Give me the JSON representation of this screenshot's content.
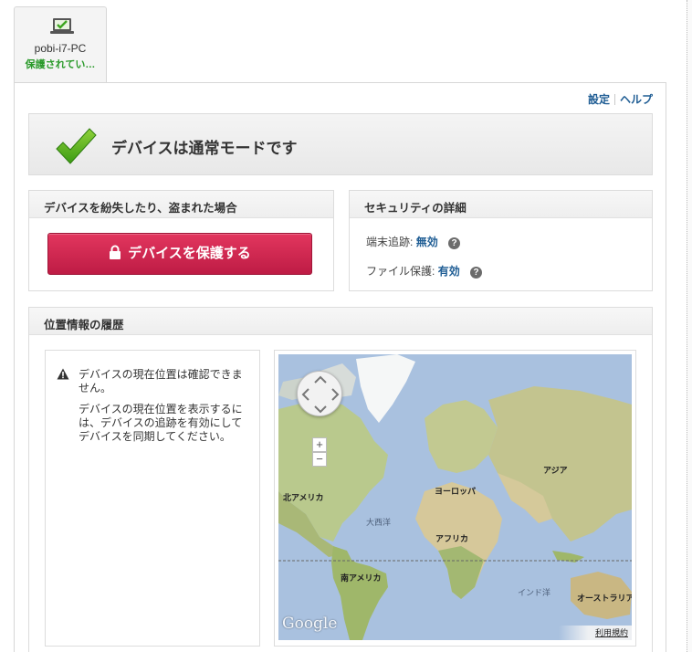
{
  "device": {
    "name": "pobi-i7-PC",
    "status": "保護されてい…"
  },
  "top_links": {
    "settings": "設定",
    "help": "ヘルプ"
  },
  "status": {
    "message": "デバイスは通常モードです",
    "icon": "checkmark-icon",
    "color": "#4caf1f"
  },
  "lost": {
    "header": "デバイスを紛失したり、盗まれた場合",
    "button_label": "デバイスを保護する",
    "button_color": "#d42a52"
  },
  "security": {
    "header": "セキュリティの詳細",
    "tracking_label": "端末追跡:",
    "tracking_value": "無効",
    "file_label": "ファイル保護:",
    "file_value": "有効"
  },
  "location": {
    "header": "位置情報の履歴",
    "message_1": "デバイスの現在位置は確認できません。",
    "message_2": "デバイスの現在位置を表示するには、デバイスの追跡を有効にしてデバイスを同期してください。",
    "map": {
      "labels": {
        "north_america": "北アメリカ",
        "atlantic": "大西洋",
        "europe": "ヨーロッパ",
        "asia": "アジア",
        "africa": "アフリカ",
        "south_america": "南アメリカ",
        "indian_ocean": "インド洋",
        "australia": "オーストラリア"
      },
      "zoom_in": "+",
      "zoom_out": "−",
      "google": "Google",
      "terms": "利用規約"
    }
  }
}
